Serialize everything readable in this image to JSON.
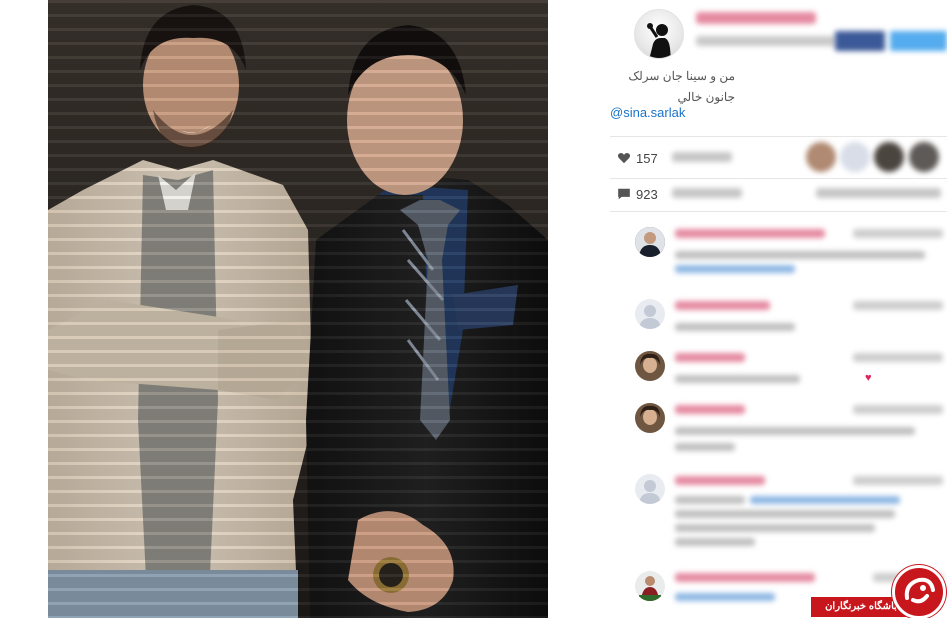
{
  "post": {
    "caption_line1": "من و سینا جان سرلک",
    "caption_line2": "جانون خالي",
    "mention": "@sina.sarlak",
    "likes_count": "157",
    "comments_count": "923"
  },
  "watermark": {
    "text": "باشگاه خبرنگاران"
  },
  "colors": {
    "mention_blue": "#1a73c9",
    "facebook_blue": "#3b5998",
    "twitter_blue": "#55acee",
    "watermark_red": "#c8161d",
    "username_pink": "#e58aa1"
  },
  "icons": {
    "likes": "heart-icon",
    "comments": "speech-bubble-icon",
    "avatar": "microphone-singer-icon"
  }
}
